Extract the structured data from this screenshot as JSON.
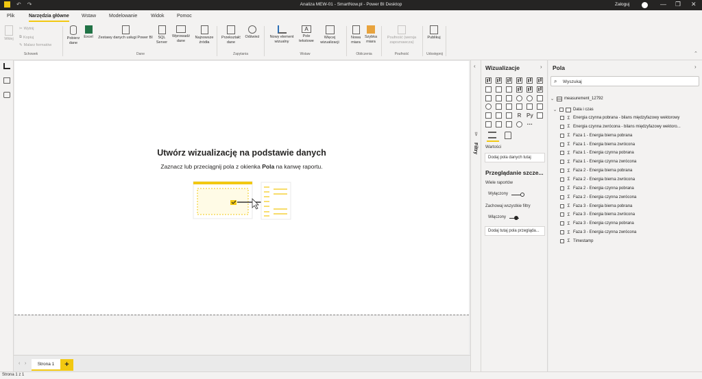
{
  "window": {
    "title": "Analiza MEW-01 - SmartNow.pl - Power BI Desktop",
    "user": "Zaloguj",
    "controls": [
      "—",
      "❐",
      "✕"
    ]
  },
  "menu": {
    "tabs": [
      "Plik",
      "Narzędzia główne",
      "Wstaw",
      "Modelowanie",
      "Widok",
      "Pomoc"
    ]
  },
  "ribbon": {
    "paste": "Wklej",
    "cut": "Wytnij",
    "copy": "Kopiuj",
    "format_painter": "Malarz formatów",
    "group_clipboard": "Schowek",
    "get_data": "Pobierz dane",
    "excel": "Excel",
    "pbi_datasets": "Zestawy danych usługi Power BI",
    "sql": "SQL Server",
    "enter_data": "Wprowadź dane",
    "recent_sources": "Najnowsze źródła",
    "group_data": "Dane",
    "transform": "Przekształć dane",
    "refresh": "Odśwież",
    "group_queries": "Zapytania",
    "new_visual": "Nowy element wizualny",
    "text_box": "Pole tekstowe",
    "more_visuals": "Więcej wizualizacji",
    "group_insert": "Wstaw",
    "new_measure": "Nowa miara",
    "quick_measure": "Szybka miara",
    "group_calc": "Obliczenia",
    "sensitivity": "Poufność (wersja zapoznawcza)",
    "group_sensitivity": "Poufność",
    "publish": "Publikuj",
    "group_share": "Udostępnij"
  },
  "canvas": {
    "empty_title": "Utwórz wizualizację na podstawie danych",
    "empty_sub_before": "Zaznacz lub przeciągnij pola z okienka ",
    "empty_sub_bold": "Pola",
    "empty_sub_after": " na kanwę raportu."
  },
  "pages": {
    "tabs": [
      "Strona 1"
    ],
    "add": "+"
  },
  "status": "Strona 1 z 1",
  "filters": {
    "label": "Filtry"
  },
  "visualizations": {
    "title": "Wizualizacje",
    "values_label": "Wartości",
    "values_placeholder": "Dodaj pola danych tutaj",
    "drillthrough_title": "Przeglądanie szcze...",
    "cross_report_label": "Wiele raportów",
    "cross_report_state": "Wyłączony",
    "keep_filters_label": "Zachowaj wszystkie filtry",
    "keep_filters_state": "Włączony",
    "drill_placeholder": "Dodaj tutaj pola przegląda..."
  },
  "fields": {
    "title": "Pola",
    "search_placeholder": "Wyszukaj",
    "table": "measurement_12792",
    "date_group": "Data i czas",
    "items": [
      "Energia czynna pobrana - bilans międzyfazowy wektorowy",
      "Energia czynna zwrócona - bilans międzyfazowy wektoro...",
      "Faza 1 - Energia bierna pobrana",
      "Faza 1 - Energia bierna zwrócona",
      "Faza 1 - Energia czynna pobrana",
      "Faza 1 - Energia czynna zwrócona",
      "Faza 2 - Energia bierna pobrana",
      "Faza 2 - Energia bierna zwrócona",
      "Faza 2 - Energia czynna pobrana",
      "Faza 2 - Energia czynna zwrócona",
      "Faza 3 - Energia bierna pobrana",
      "Faza 3 - Energia bierna zwrócona",
      "Faza 3 - Energia czynna pobrana",
      "Faza 3 - Energia czynna zwrócona",
      "Timestamp"
    ]
  },
  "colors": {
    "accent": "#f2c811",
    "titlebar": "#252423",
    "pane": "#f3f2f1"
  }
}
